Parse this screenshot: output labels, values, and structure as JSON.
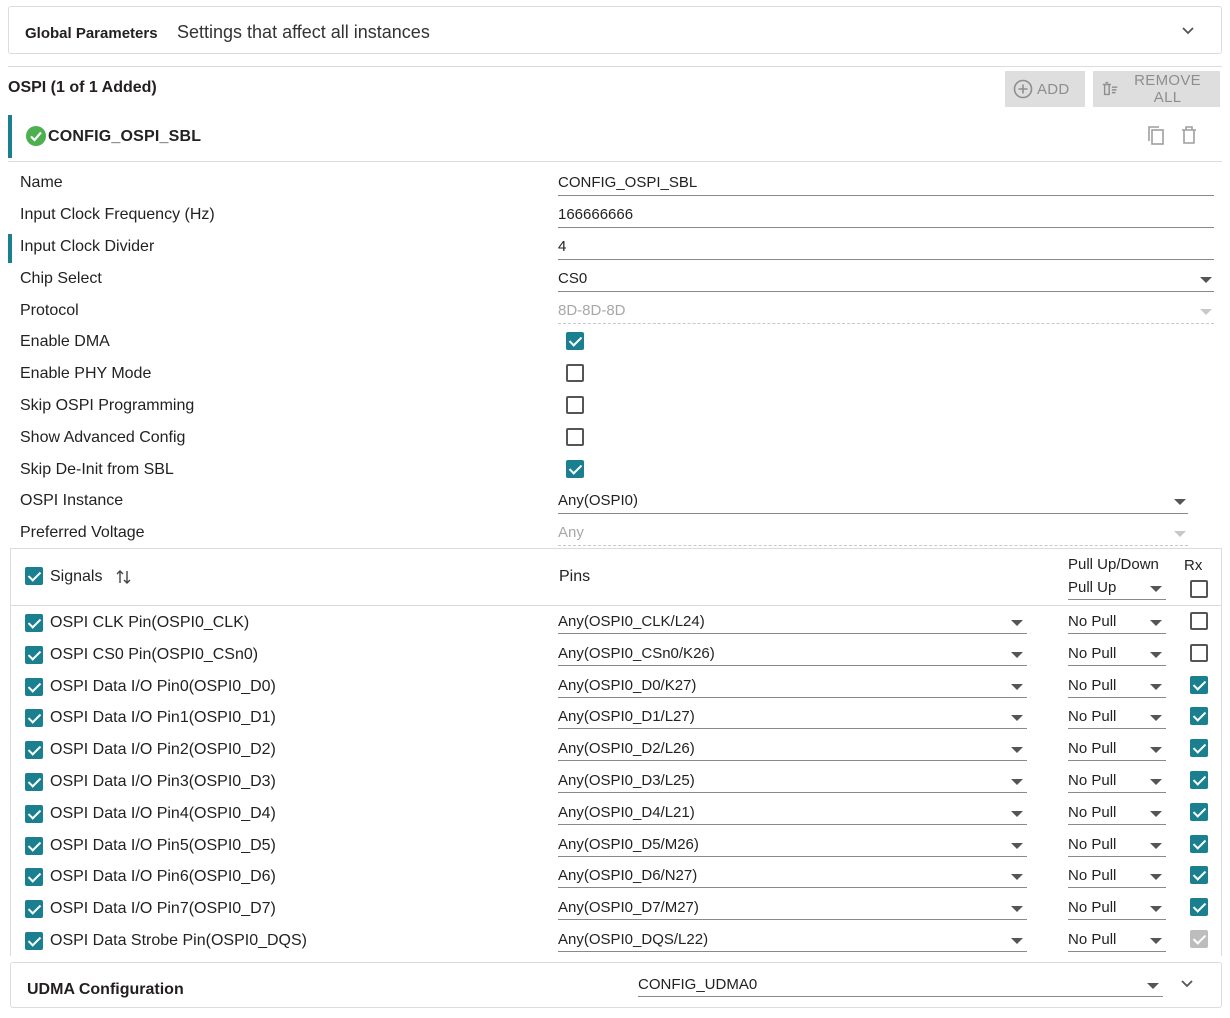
{
  "global": {
    "title": "Global Parameters",
    "description": "Settings that affect all instances"
  },
  "ospi": {
    "title": "OSPI (1 of 1 Added)",
    "add_label": "ADD",
    "remove_all_label": "REMOVE ALL",
    "instance_name": "CONFIG_OSPI_SBL"
  },
  "colors": {
    "accent": "#1a7f8e",
    "success": "#4caf50",
    "disabled": "#dedede"
  },
  "fields": [
    {
      "label": "Name",
      "value": "CONFIG_OSPI_SBL",
      "type": "text"
    },
    {
      "label": "Input Clock Frequency (Hz)",
      "value": "166666666",
      "type": "text"
    },
    {
      "label": "Input Clock Divider",
      "value": "4",
      "type": "text"
    },
    {
      "label": "Chip Select",
      "value": "CS0",
      "type": "select"
    },
    {
      "label": "Protocol",
      "value": "8D-8D-8D",
      "type": "select-disabled"
    },
    {
      "label": "Enable DMA",
      "checked": true,
      "type": "checkbox"
    },
    {
      "label": "Enable PHY Mode",
      "checked": false,
      "type": "checkbox"
    },
    {
      "label": "Skip OSPI Programming",
      "checked": false,
      "type": "checkbox"
    },
    {
      "label": "Show Advanced Config",
      "checked": false,
      "type": "checkbox"
    },
    {
      "label": "Skip De-Init from SBL",
      "checked": true,
      "type": "checkbox"
    },
    {
      "label": "OSPI Instance",
      "value": "Any(OSPI0)",
      "type": "select"
    },
    {
      "label": "Preferred Voltage",
      "value": "Any",
      "type": "select-disabled"
    }
  ],
  "signals": {
    "header": {
      "signals_label": "Signals",
      "pins_label": "Pins",
      "pull_label": "Pull Up/Down",
      "pull_value": "Pull Up",
      "rx_label": "Rx",
      "all_checked": true,
      "rx_all_checked": false
    },
    "rows": [
      {
        "name": "OSPI CLK Pin(OSPI0_CLK)",
        "pin": "Any(OSPI0_CLK/L24)",
        "pull": "No Pull",
        "checked": true,
        "rx": "off"
      },
      {
        "name": "OSPI CS0 Pin(OSPI0_CSn0)",
        "pin": "Any(OSPI0_CSn0/K26)",
        "pull": "No Pull",
        "checked": true,
        "rx": "off"
      },
      {
        "name": "OSPI Data I/O Pin0(OSPI0_D0)",
        "pin": "Any(OSPI0_D0/K27)",
        "pull": "No Pull",
        "checked": true,
        "rx": "on"
      },
      {
        "name": "OSPI Data I/O Pin1(OSPI0_D1)",
        "pin": "Any(OSPI0_D1/L27)",
        "pull": "No Pull",
        "checked": true,
        "rx": "on"
      },
      {
        "name": "OSPI Data I/O Pin2(OSPI0_D2)",
        "pin": "Any(OSPI0_D2/L26)",
        "pull": "No Pull",
        "checked": true,
        "rx": "on"
      },
      {
        "name": "OSPI Data I/O Pin3(OSPI0_D3)",
        "pin": "Any(OSPI0_D3/L25)",
        "pull": "No Pull",
        "checked": true,
        "rx": "on"
      },
      {
        "name": "OSPI Data I/O Pin4(OSPI0_D4)",
        "pin": "Any(OSPI0_D4/L21)",
        "pull": "No Pull",
        "checked": true,
        "rx": "on"
      },
      {
        "name": "OSPI Data I/O Pin5(OSPI0_D5)",
        "pin": "Any(OSPI0_D5/M26)",
        "pull": "No Pull",
        "checked": true,
        "rx": "on"
      },
      {
        "name": "OSPI Data I/O Pin6(OSPI0_D6)",
        "pin": "Any(OSPI0_D6/N27)",
        "pull": "No Pull",
        "checked": true,
        "rx": "on"
      },
      {
        "name": "OSPI Data I/O Pin7(OSPI0_D7)",
        "pin": "Any(OSPI0_D7/M27)",
        "pull": "No Pull",
        "checked": true,
        "rx": "on"
      },
      {
        "name": "OSPI Data Strobe Pin(OSPI0_DQS)",
        "pin": "Any(OSPI0_DQS/L22)",
        "pull": "No Pull",
        "checked": true,
        "rx": "disabled"
      }
    ]
  },
  "udma": {
    "title": "UDMA Configuration",
    "value": "CONFIG_UDMA0"
  }
}
